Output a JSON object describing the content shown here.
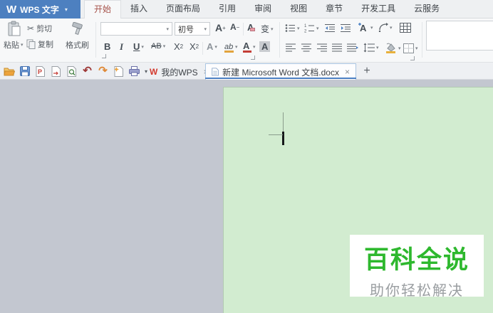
{
  "app": {
    "logo_glyph": "W",
    "title": "WPS 文字",
    "brand_color": "#4d80c0"
  },
  "glyphs": {
    "dropdown": "▾",
    "close": "×",
    "plus": "+",
    "scissors": "✂",
    "undo": "↶",
    "redo": "↷"
  },
  "menu": {
    "tabs": [
      {
        "label": "开始",
        "active": true
      },
      {
        "label": "插入"
      },
      {
        "label": "页面布局"
      },
      {
        "label": "引用"
      },
      {
        "label": "审阅"
      },
      {
        "label": "视图"
      },
      {
        "label": "章节"
      },
      {
        "label": "开发工具"
      },
      {
        "label": "云服务"
      }
    ]
  },
  "ribbon": {
    "clipboard": {
      "paste": "粘贴",
      "cut": "剪切",
      "copy": "复制",
      "format_painter": "格式刷"
    },
    "font": {
      "name_value": "",
      "size_value": "初号",
      "bold": "B",
      "italic": "I",
      "underline": "U",
      "strikethrough": "AB",
      "superscript_base": "X",
      "superscript_exp": "2",
      "subscript_base": "X",
      "subscript_sub": "2",
      "grow_base": "A",
      "grow_sign": "+",
      "shrink_base": "A",
      "shrink_sign": "−",
      "clear_format": "A",
      "pinyin_guide": "变",
      "text_effect": "A",
      "highlight": "ab",
      "font_color": "A",
      "char_shading": "A"
    }
  },
  "tabs_bar": {
    "doc_tabs": [
      {
        "label": "我的WPS",
        "active": false
      },
      {
        "label": "新建 Microsoft Word 文档.docx",
        "active": true
      }
    ]
  },
  "watermark": {
    "title": "百科全说",
    "subtitle": "助你轻松解决",
    "title_color": "#2eb82e"
  },
  "colors": {
    "page_green": "#d2ecd0",
    "doc_background": "#c3c7d0",
    "active_tab_text": "#a6524a",
    "tab_accent": "#4b7fc3"
  }
}
